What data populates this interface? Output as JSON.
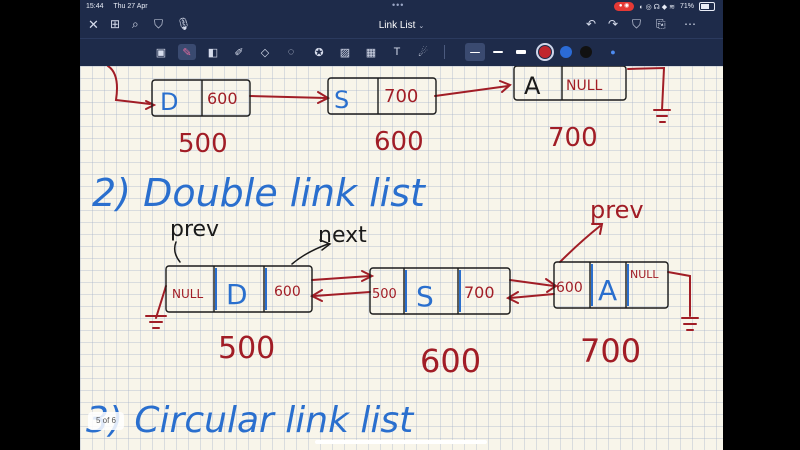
{
  "status": {
    "time": "15:44",
    "date": "Thu 27 Apr",
    "battery": "71%",
    "dots": "•••"
  },
  "nav": {
    "title": "Link List"
  },
  "toolbar": {
    "tools": [
      "scan-icon",
      "pen-icon",
      "eraser-icon",
      "highlighter-icon",
      "shapes-icon",
      "lasso-icon",
      "star-icon",
      "image-icon",
      "camera-icon",
      "text-icon",
      "pointer-icon"
    ],
    "colors": [
      "#111111",
      "#c0262d",
      "#2b6bd6",
      "#111111"
    ],
    "selected_color": "#c0262d",
    "colors_label": "pen colors"
  },
  "page": {
    "pager": "5 of 6",
    "row1": {
      "nodes": [
        {
          "data": "D",
          "next": "600",
          "addr": "500"
        },
        {
          "data": "S",
          "next": "700",
          "addr": "600"
        },
        {
          "data": "A",
          "next": "NULL",
          "addr": "700"
        }
      ]
    },
    "heading2": "2) Double link list",
    "row2": {
      "label_prev": "prev",
      "label_next": "next",
      "label_prev2": "prev",
      "nodes": [
        {
          "prev": "NULL",
          "data": "D",
          "next": "600",
          "addr": "500"
        },
        {
          "prev": "500",
          "data": "S",
          "next": "700",
          "addr": "600"
        },
        {
          "prev": "600",
          "data": "A",
          "next": "NULL",
          "addr": "700"
        }
      ]
    },
    "heading3": "3) Circular link list"
  },
  "ink_colors": {
    "red": "#a11d26",
    "blue": "#2a6fce",
    "black": "#1a1a1a"
  }
}
